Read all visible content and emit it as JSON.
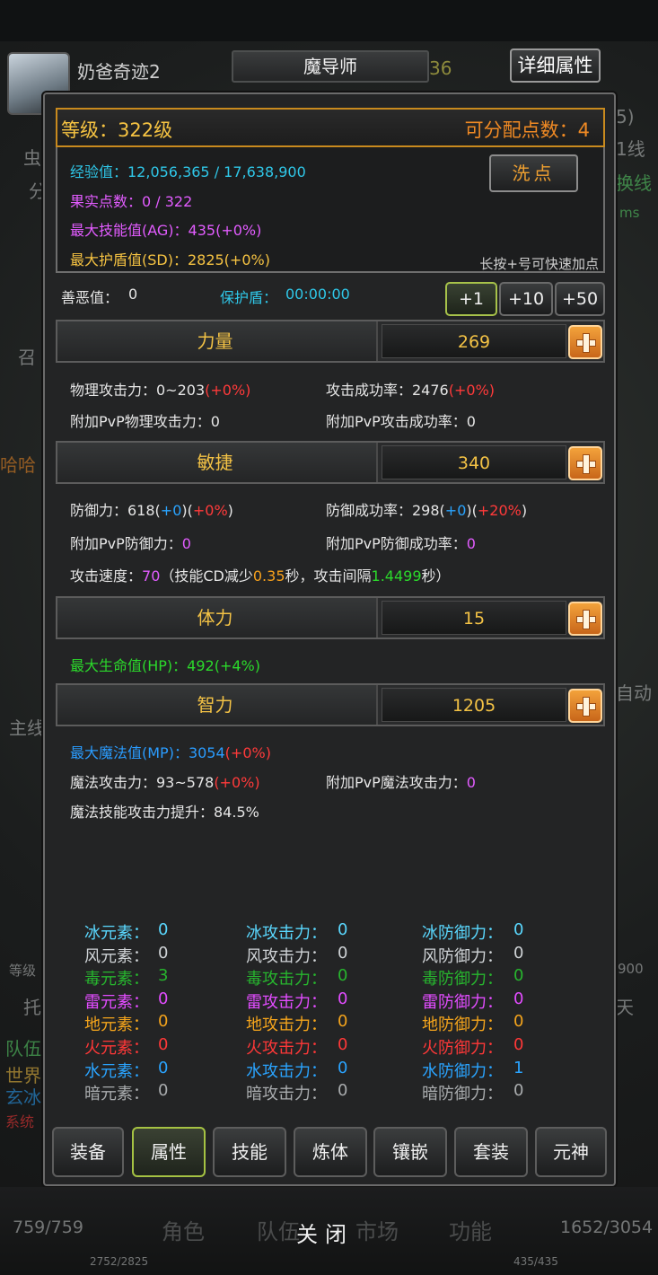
{
  "background": {
    "hp": "759/759",
    "mp": "1652/3054",
    "left_sub": "2752/2825",
    "right_sub": "435/435",
    "nav": [
      "角色",
      "队伍",
      "市场",
      "功能"
    ],
    "side_texts": [
      "虫",
      "分",
      "召",
      "哈哈",
      "主线",
      "等级",
      "托",
      "队伍",
      "世界",
      "玄冰",
      "系统",
      "5)",
      "1线",
      "换线",
      "ms",
      "自动",
      "900",
      "天"
    ]
  },
  "header": {
    "player_name": "奶爸奇迹2",
    "class_name": "魔导师",
    "ghost_level": "36",
    "detail_button": "详细属性"
  },
  "summary": {
    "level": "等级：322级",
    "points": "可分配点数：4",
    "exp": "经验值：12,056,365 / 17,638,900",
    "fruit": "果实点数：0 / 322",
    "ag": "最大技能值(AG)：435(+0%)",
    "sd": "最大护盾值(SD)：2825(+0%)",
    "wash_button": "洗点",
    "hint": "长按+号可快速加点"
  },
  "status": {
    "karma_label": "善恶值：",
    "karma_value": "0",
    "shield_label": "保护盾：",
    "shield_value": "00:00:00"
  },
  "steps": [
    "+1",
    "+10",
    "+50"
  ],
  "stats": {
    "strength": {
      "label": "力量",
      "value": "269"
    },
    "agility": {
      "label": "敏捷",
      "value": "340"
    },
    "vitality": {
      "label": "体力",
      "value": "15"
    },
    "energy": {
      "label": "智力",
      "value": "1205"
    }
  },
  "strength_details": {
    "phys_atk": "物理攻击力：0~203",
    "phys_atk_pct": "(+0%)",
    "hit_rate": "攻击成功率：2476",
    "hit_rate_pct": "(+0%)",
    "pvp_phys": "附加PvP物理攻击力：0",
    "pvp_hit": "附加PvP攻击成功率：0"
  },
  "agility_details": {
    "defense": "防御力：618",
    "defense_add": "+0",
    "defense_pct": "+0%",
    "block": "防御成功率：298",
    "block_add": "+0",
    "block_pct": "+20%",
    "pvp_def_label": "附加PvP防御力：",
    "pvp_def_value": "0",
    "pvp_block_label": "附加PvP防御成功率：",
    "pvp_block_value": "0",
    "speed_label": "攻击速度：",
    "speed_value": "70",
    "speed_note_1": "（技能CD减少",
    "speed_cd": "0.35",
    "speed_note_2": "秒，攻击间隔",
    "speed_interval": "1.4499",
    "speed_note_3": "秒）"
  },
  "vitality_details": {
    "hp": "最大生命值(HP)：492(+4%)"
  },
  "energy_details": {
    "mp": "最大魔法值(MP)：3054",
    "mp_pct": "(+0%)",
    "magic_atk": "魔法攻击力：93~578",
    "magic_atk_pct": "(+0%)",
    "pvp_magic_label": "附加PvP魔法攻击力：",
    "pvp_magic_value": "0",
    "skill_boost": "魔法技能攻击力提升：84.5%"
  },
  "elements": [
    {
      "color": "#5ad8ff",
      "elem": "冰元素：",
      "elem_val": "0",
      "atk": "冰攻击力：",
      "atk_val": "0",
      "def": "冰防御力：",
      "def_val": "0"
    },
    {
      "color": "#cfd3d6",
      "elem": "风元素：",
      "elem_val": "0",
      "atk": "风攻击力：",
      "atk_val": "0",
      "def": "风防御力：",
      "def_val": "0"
    },
    {
      "color": "#27b52e",
      "elem": "毒元素：",
      "elem_val": "3",
      "atk": "毒攻击力：",
      "atk_val": "0",
      "def": "毒防御力：",
      "def_val": "0"
    },
    {
      "color": "#e24cff",
      "elem": "雷元素：",
      "elem_val": "0",
      "atk": "雷攻击力：",
      "atk_val": "0",
      "def": "雷防御力：",
      "def_val": "0"
    },
    {
      "color": "#f4a41c",
      "elem": "地元素：",
      "elem_val": "0",
      "atk": "地攻击力：",
      "atk_val": "0",
      "def": "地防御力：",
      "def_val": "0"
    },
    {
      "color": "#ff3838",
      "elem": "火元素：",
      "elem_val": "0",
      "atk": "火攻击力：",
      "atk_val": "0",
      "def": "火防御力：",
      "def_val": "0"
    },
    {
      "color": "#2aa4ff",
      "elem": "水元素：",
      "elem_val": "0",
      "atk": "水攻击力：",
      "atk_val": "0",
      "def": "水防御力：",
      "def_val": "1"
    },
    {
      "color": "#a9acae",
      "elem": "暗元素：",
      "elem_val": "0",
      "atk": "暗攻击力：",
      "atk_val": "0",
      "def": "暗防御力：",
      "def_val": "0"
    }
  ],
  "tabs": [
    "装备",
    "属性",
    "技能",
    "炼体",
    "镶嵌",
    "套装",
    "元神"
  ],
  "close_label": "关闭"
}
